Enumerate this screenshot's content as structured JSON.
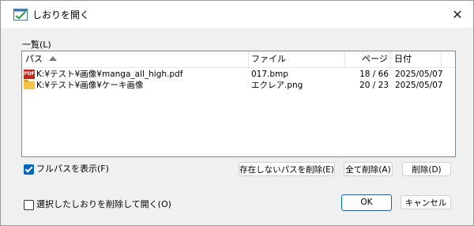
{
  "window": {
    "title": "しおりを開く",
    "close_glyph": "✕"
  },
  "list": {
    "label": "一覧(L)",
    "columns": [
      "パス",
      "ファイル",
      "ページ",
      "日付"
    ],
    "rows": [
      {
        "icon": "pdf-icon",
        "path": "K:¥テスト¥画像¥manga_all_high.pdf",
        "file": "017.bmp",
        "page": "18 / 66",
        "date": "2025/05/07"
      },
      {
        "icon": "folder-icon",
        "path": "K:¥テスト¥画像¥ケーキ画像",
        "file": "エクレア.png",
        "page": "20 / 23",
        "date": "2025/05/07"
      }
    ]
  },
  "options": {
    "full_path": {
      "label": "フルパスを表示(F)",
      "checked": true
    },
    "delete_after_open": {
      "label": "選択したしおりを削除して開く(O)",
      "checked": false
    }
  },
  "buttons": {
    "delete_missing": "存在しないパスを削除(E)",
    "delete_all": "全て削除(A)",
    "delete": "削除(D)",
    "ok": "OK",
    "cancel": "キャンセル"
  },
  "icons": {
    "app": "bookmark-open-icon",
    "sort": "sort-ascending-icon"
  },
  "colors": {
    "accent": "#0067c0",
    "pdf": "#c0281e",
    "folder": "#f3c447"
  }
}
